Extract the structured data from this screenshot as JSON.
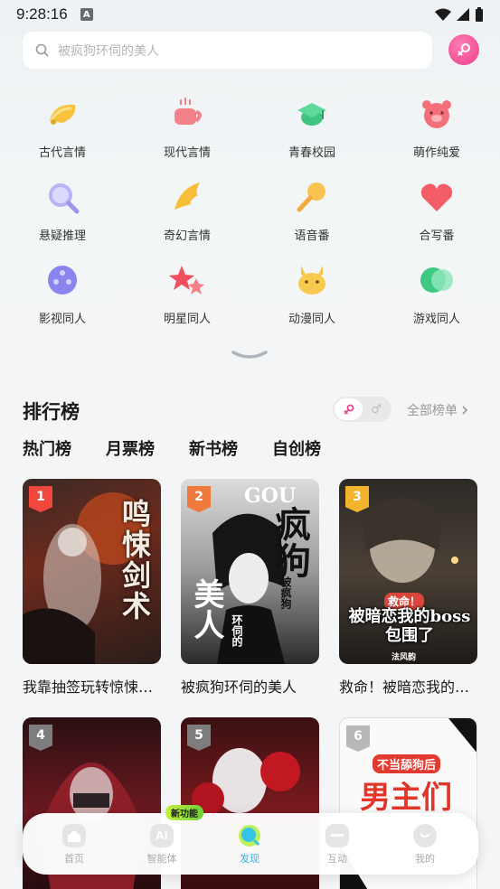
{
  "status_bar": {
    "time": "9:28:16",
    "notif_letter": "A"
  },
  "search": {
    "placeholder": "被疯狗环伺的美人"
  },
  "categories": [
    {
      "label": "古代言情",
      "icon": "fan-icon"
    },
    {
      "label": "现代言情",
      "icon": "coffee-cup-icon"
    },
    {
      "label": "青春校园",
      "icon": "graduation-cap-icon"
    },
    {
      "label": "萌作纯爱",
      "icon": "pig-face-icon"
    },
    {
      "label": "悬疑推理",
      "icon": "magnifier-icon"
    },
    {
      "label": "奇幻言情",
      "icon": "wing-icon"
    },
    {
      "label": "语音番",
      "icon": "microphone-icon"
    },
    {
      "label": "合写番",
      "icon": "heart-icon"
    },
    {
      "label": "影视同人",
      "icon": "film-reel-icon"
    },
    {
      "label": "明星同人",
      "icon": "stars-icon"
    },
    {
      "label": "动漫同人",
      "icon": "pikachu-face-icon"
    },
    {
      "label": "游戏同人",
      "icon": "game-controller-icon"
    }
  ],
  "ranking": {
    "title": "排行榜",
    "toggle_off_symbol": "♂",
    "all_label": "全部榜单",
    "tabs": [
      "热门榜",
      "月票榜",
      "新书榜",
      "自创榜"
    ],
    "active_tab": "热门榜",
    "books": [
      {
        "rank": "1",
        "title": "我靠抽签玩转惊悚游戏",
        "cover_text": "鸣悚剑术",
        "badge_color": "#f2473d"
      },
      {
        "rank": "2",
        "title": "被疯狗环伺的美人",
        "cover_text": "疯狗",
        "badge_color": "#f07a3c"
      },
      {
        "rank": "3",
        "title": "救命！被暗恋我的boss包围了！",
        "cover_text": "被暗恋我的boss包围了",
        "badge_color": "#f3b32d"
      },
      {
        "rank": "4",
        "title": "",
        "cover_text": "",
        "badge_color": "#a8a8a8"
      },
      {
        "rank": "5",
        "title": "",
        "cover_text": "",
        "badge_color": "#a8a8a8"
      },
      {
        "rank": "6",
        "title": "",
        "cover_text": "男主们",
        "badge_color": "#b8b8b8"
      }
    ],
    "cover_subtexts": {
      "book2_top": "GOU",
      "book2_side": "被疯狗",
      "book2_bottom": "美人",
      "book2_mid": "环伺的",
      "book3_top": "救命！",
      "book3_footer": "法风韵",
      "book6_top": "不当舔狗后"
    }
  },
  "bottom_nav": {
    "items": [
      {
        "label": "首页",
        "icon": "home-icon"
      },
      {
        "label": "智能体",
        "icon": "ai-icon",
        "icon_text": "AI"
      },
      {
        "label": "发现",
        "icon": "discover-icon",
        "active": true
      },
      {
        "label": "互动",
        "icon": "chat-icon"
      },
      {
        "label": "我的",
        "icon": "profile-icon"
      }
    ],
    "new_badge": "新功能"
  }
}
